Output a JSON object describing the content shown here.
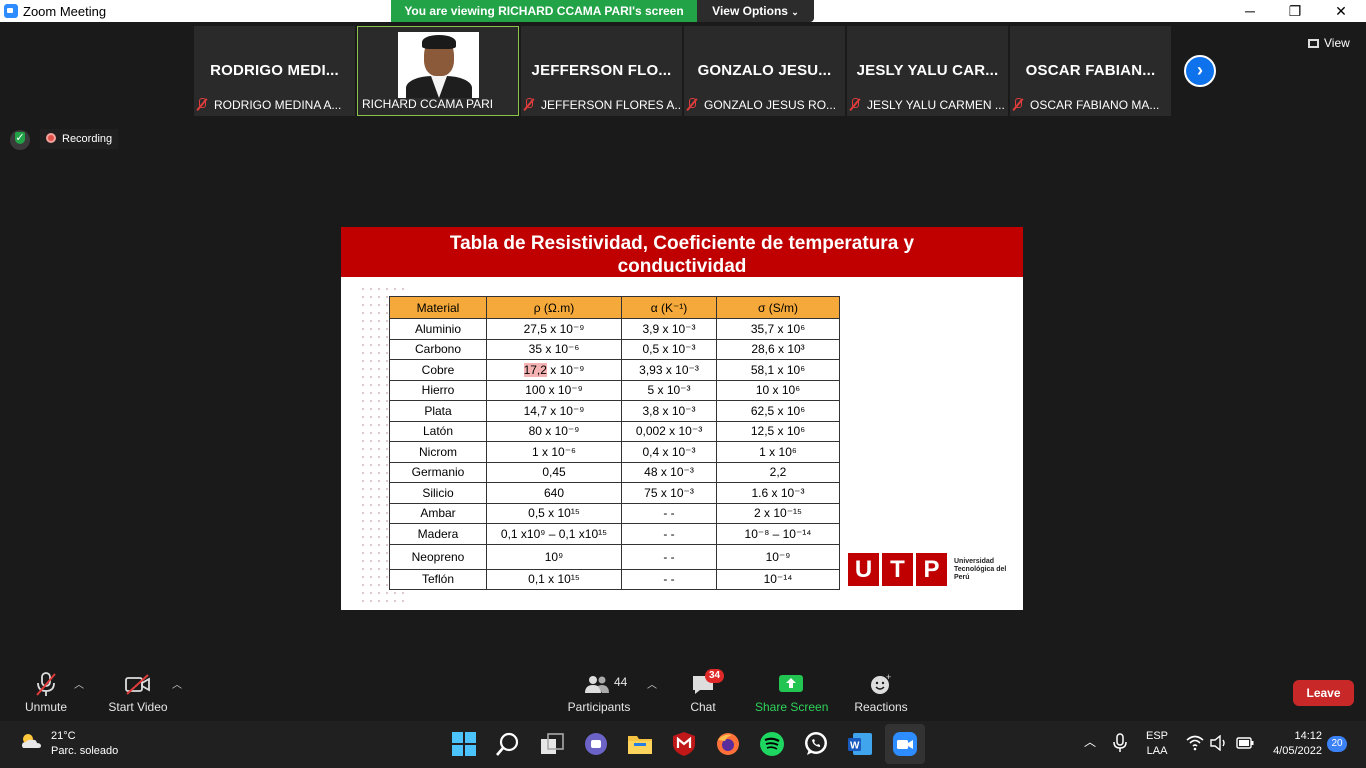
{
  "window": {
    "title": "Zoom Meeting"
  },
  "banner": {
    "viewing": "You are viewing RICHARD CCAMA PARI's screen",
    "view_options": "View Options"
  },
  "gallery": {
    "view_label": "View",
    "tiles": [
      {
        "big_name": "RODRIGO MEDI...",
        "label": "RODRIGO MEDINA A...",
        "muted": true
      },
      {
        "big_name": "",
        "label": "RICHARD CCAMA PARI",
        "muted": false
      },
      {
        "big_name": "JEFFERSON FLO...",
        "label": "JEFFERSON FLORES A...",
        "muted": true
      },
      {
        "big_name": "GONZALO JESU...",
        "label": "GONZALO JESUS RO...",
        "muted": true
      },
      {
        "big_name": "JESLY YALU CAR...",
        "label": "JESLY YALU CARMEN ...",
        "muted": true
      },
      {
        "big_name": "OSCAR FABIAN...",
        "label": "OSCAR FABIANO MA...",
        "muted": true
      }
    ]
  },
  "status": {
    "recording": "Recording"
  },
  "slide": {
    "title_line1": "Tabla de Resistividad, Coeficiente de temperatura y",
    "title_line2": "conductividad",
    "headers": [
      "Material",
      "ρ (Ω.m)",
      "α (K⁻¹)",
      "σ (S/m)"
    ],
    "rows": [
      [
        "Aluminio",
        "27,5 x 10⁻⁹",
        "3,9 x 10⁻³",
        "35,7 x 10⁶"
      ],
      [
        "Carbono",
        "35 x 10⁻⁶",
        "0,5 x 10⁻³",
        "28,6 x 10³"
      ],
      [
        "Cobre",
        "17,2 x 10⁻⁹",
        "3,93 x 10⁻³",
        "58,1 x 10⁶"
      ],
      [
        "Hierro",
        "100 x 10⁻⁹",
        "5 x 10⁻³",
        "10 x 10⁶"
      ],
      [
        "Plata",
        "14,7 x 10⁻⁹",
        "3,8 x 10⁻³",
        "62,5 x 10⁶"
      ],
      [
        "Latón",
        "80 x 10⁻⁹",
        "0,002 x 10⁻³",
        "12,5 x 10⁶"
      ],
      [
        "Nicrom",
        "1 x 10⁻⁶",
        "0,4 x 10⁻³",
        "1 x 10⁶"
      ],
      [
        "Germanio",
        "0,45",
        "48 x 10⁻³",
        "2,2"
      ],
      [
        "Silicio",
        "640",
        "75 x 10⁻³",
        "1.6 x 10⁻³"
      ],
      [
        "Ambar",
        "0,5 x 10¹⁵",
        "- -",
        "2 x 10⁻¹⁵"
      ],
      [
        "Madera",
        "0,1 x10⁹ – 0,1 x10¹⁵",
        "- -",
        "10⁻⁸ – 10⁻¹⁴"
      ],
      [
        "Neopreno",
        "10⁹",
        "- -",
        "10⁻⁹"
      ],
      [
        "Teflón",
        "0,1 x 10¹⁵",
        "- -",
        "10⁻¹⁴"
      ]
    ],
    "logo_letters": [
      "U",
      "T",
      "P"
    ],
    "logo_text": "Universidad Tecnológica del Perú"
  },
  "controls": {
    "unmute": "Unmute",
    "start_video": "Start Video",
    "participants": "Participants",
    "participants_count": "44",
    "chat": "Chat",
    "chat_badge": "34",
    "share_screen": "Share Screen",
    "reactions": "Reactions",
    "leave": "Leave"
  },
  "taskbar": {
    "temperature": "21°C",
    "weather": "Parc. soleado",
    "lang1": "ESP",
    "lang2": "LAA",
    "time": "14:12",
    "date": "4/05/2022",
    "notifications": "20"
  },
  "colors": {
    "accent_red": "#c00000",
    "header_orange": "#f4a93a",
    "banner_green": "#23a348",
    "zoom_blue": "#0e72ed"
  }
}
